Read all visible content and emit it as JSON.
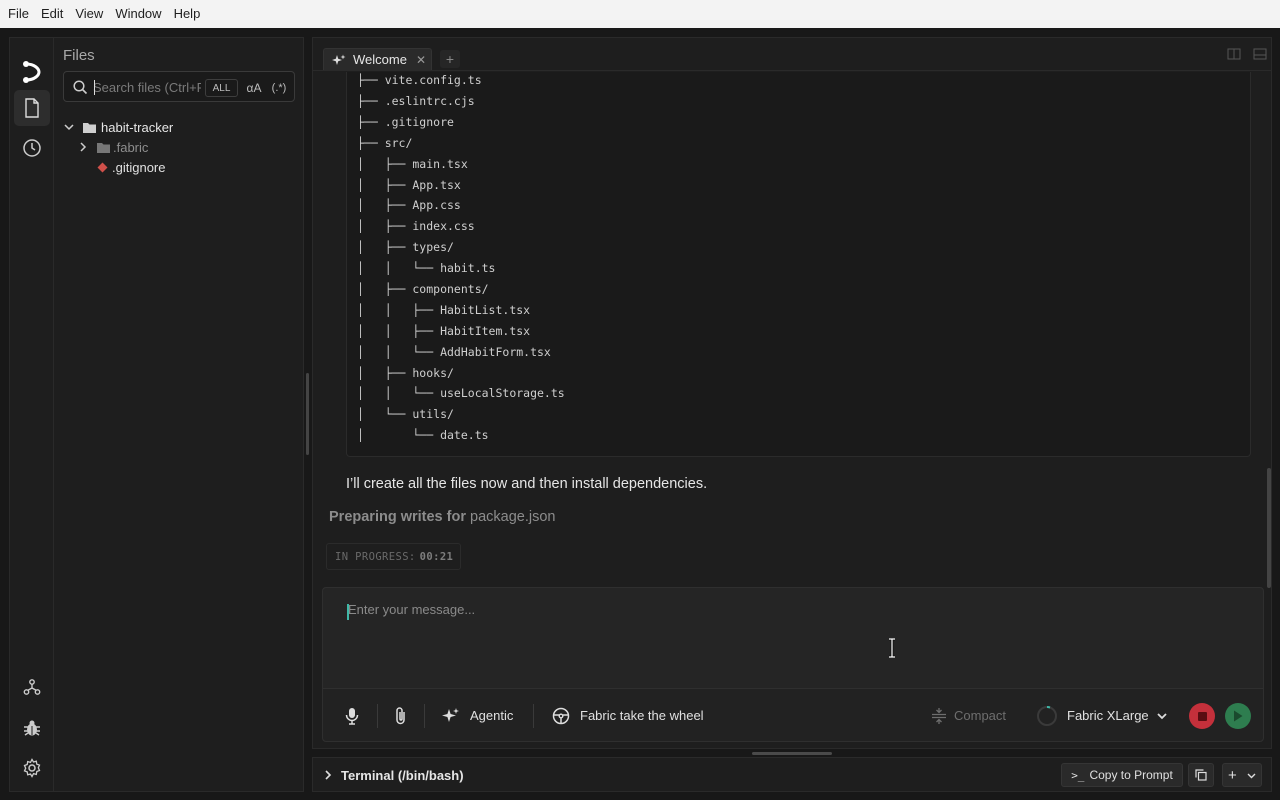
{
  "menubar": {
    "file": "File",
    "edit": "Edit",
    "view": "View",
    "window": "Window",
    "help": "Help"
  },
  "sidebar": {
    "title": "Files",
    "search_placeholder": "Search files (Ctrl+P)",
    "filter_all": "ALL",
    "filter_case": "αA",
    "filter_regex": "(.*)",
    "tree": [
      {
        "label": "habit-tracker",
        "kind": "folder",
        "expanded": true
      },
      {
        "label": ".fabric",
        "kind": "folder",
        "expanded": false
      },
      {
        "label": ".gitignore",
        "kind": "file"
      }
    ]
  },
  "tabs": [
    {
      "label": "Welcome"
    }
  ],
  "code_lines": [
    "├── vite.config.ts",
    "├── .eslintrc.cjs",
    "├── .gitignore",
    "├── src/",
    "│   ├── main.tsx",
    "│   ├── App.tsx",
    "│   ├── App.css",
    "│   ├── index.css",
    "│   ├── types/",
    "│   │   └── habit.ts",
    "│   ├── components/",
    "│   │   ├── HabitList.tsx",
    "│   │   ├── HabitItem.tsx",
    "│   │   └── AddHabitForm.tsx",
    "│   ├── hooks/",
    "│   │   └── useLocalStorage.ts",
    "│   └── utils/",
    "│       └── date.ts"
  ],
  "chat": {
    "message": "I’ll create all the files now and then install dependencies.",
    "preparing_prefix": "Preparing writes for",
    "preparing_file": "package.json",
    "status_label": "IN PROGRESS:",
    "status_time": "00:21"
  },
  "composer": {
    "placeholder": "Enter your message...",
    "agentic_label": "Agentic",
    "wheel_label": "Fabric take the wheel",
    "compact_label": "Compact",
    "model_label": "Fabric XLarge"
  },
  "terminal": {
    "title": "Terminal (/bin/bash)",
    "copy_label": "Copy to Prompt"
  },
  "colors": {
    "accent": "#3fb8a8",
    "stop": "#c4303b",
    "play": "#2e7d4f",
    "gitignore": "#d0504a"
  }
}
